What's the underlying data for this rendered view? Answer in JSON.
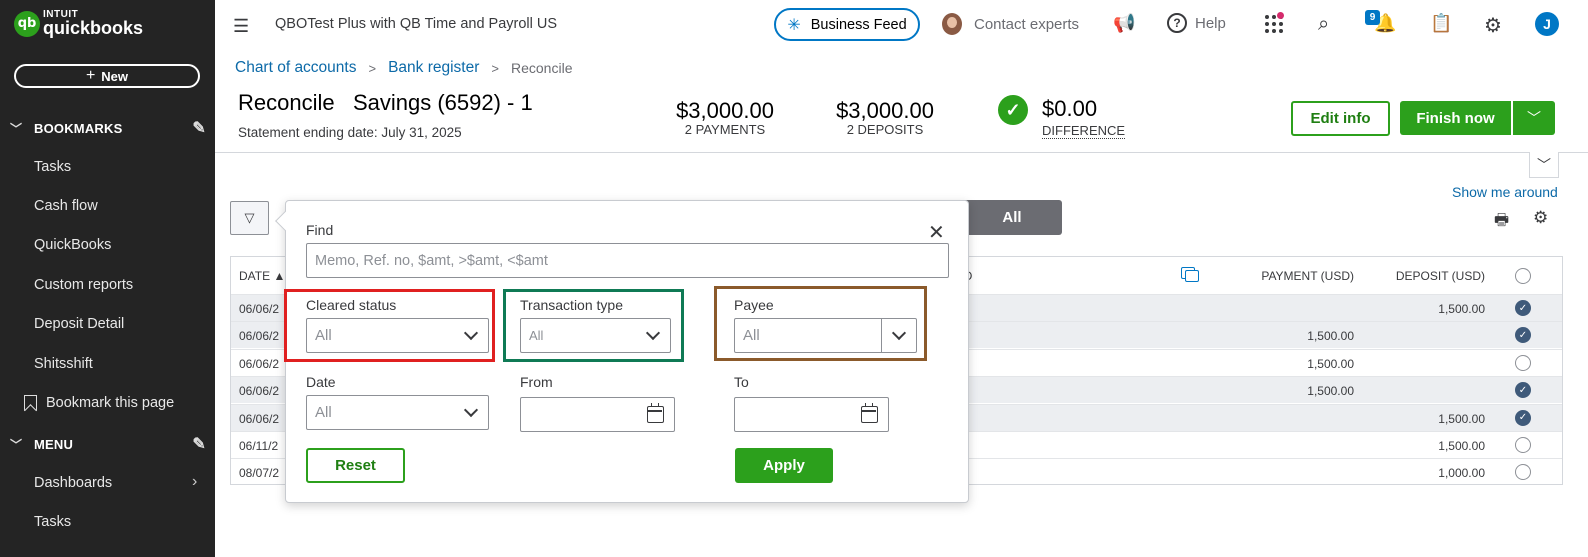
{
  "brand": {
    "intuit": "INTUIT",
    "name": "quickbooks",
    "mark": "qb"
  },
  "sidebar": {
    "new_label": "New",
    "bookmarks_label": "BOOKMARKS",
    "bookmarks": [
      "Tasks",
      "Cash flow",
      "QuickBooks",
      "Custom reports",
      "Deposit Detail",
      "Shitsshift"
    ],
    "bookmark_page": "Bookmark this page",
    "menu_label": "MENU",
    "menu_items": [
      "Dashboards",
      "Tasks"
    ]
  },
  "topbar": {
    "company": "QBOTest Plus with QB Time and Payroll US",
    "business_feed": "Business Feed",
    "contact_experts": "Contact experts",
    "help": "Help",
    "notification_count": "9",
    "user_initial": "J"
  },
  "breadcrumb": {
    "item1": "Chart of accounts",
    "item2": "Bank register",
    "current": "Reconcile"
  },
  "header": {
    "title": "Reconcile   Savings (6592) - 1",
    "statement_date": "Statement ending date: July 31, 2025",
    "payments_amount": "$3,000.00",
    "payments_label": "2 PAYMENTS",
    "deposits_amount": "$3,000.00",
    "deposits_label": "2 DEPOSITS",
    "difference_amount": "$0.00",
    "difference_label": "DIFFERENCE",
    "edit_info": "Edit info",
    "finish_now": "Finish now",
    "show_me_around": "Show me around"
  },
  "toolbar": {
    "all_tab": "All"
  },
  "table": {
    "col_date": "DATE ▲",
    "col_memo_tail": "O",
    "col_payment": "PAYMENT (USD)",
    "col_deposit": "DEPOSIT (USD)",
    "rows": [
      {
        "date": "06/06/2",
        "payment": "",
        "deposit": "1,500.00",
        "cleared": true,
        "shade": true
      },
      {
        "date": "06/06/2",
        "payment": "1,500.00",
        "deposit": "",
        "cleared": true,
        "shade": true
      },
      {
        "date": "06/06/2",
        "payment": "1,500.00",
        "deposit": "",
        "cleared": false,
        "shade": false
      },
      {
        "date": "06/06/2",
        "payment": "1,500.00",
        "deposit": "",
        "cleared": true,
        "shade": true
      },
      {
        "date": "06/06/2",
        "payment": "",
        "deposit": "1,500.00",
        "cleared": true,
        "shade": true
      },
      {
        "date": "06/11/2",
        "payment": "",
        "deposit": "1,500.00",
        "cleared": false,
        "shade": false
      },
      {
        "date": "08/07/2",
        "payment": "",
        "deposit": "1,000.00",
        "cleared": false,
        "shade": false
      }
    ]
  },
  "filter": {
    "find_label": "Find",
    "find_placeholder": "Memo, Ref. no, $amt, >$amt, <$amt",
    "cleared_label": "Cleared status",
    "cleared_value": "All",
    "type_label": "Transaction type",
    "type_value": "All",
    "payee_label": "Payee",
    "payee_value": "All",
    "date_label": "Date",
    "date_value": "All",
    "from_label": "From",
    "to_label": "To",
    "reset": "Reset",
    "apply": "Apply",
    "highlight_colors": {
      "cleared": "#e02020",
      "type": "#0f7a55",
      "payee": "#8b5a2b"
    }
  },
  "colors": {
    "accent_green": "#2ca01c",
    "link_blue": "#0d6aa8",
    "sidebar_bg": "#242424"
  }
}
